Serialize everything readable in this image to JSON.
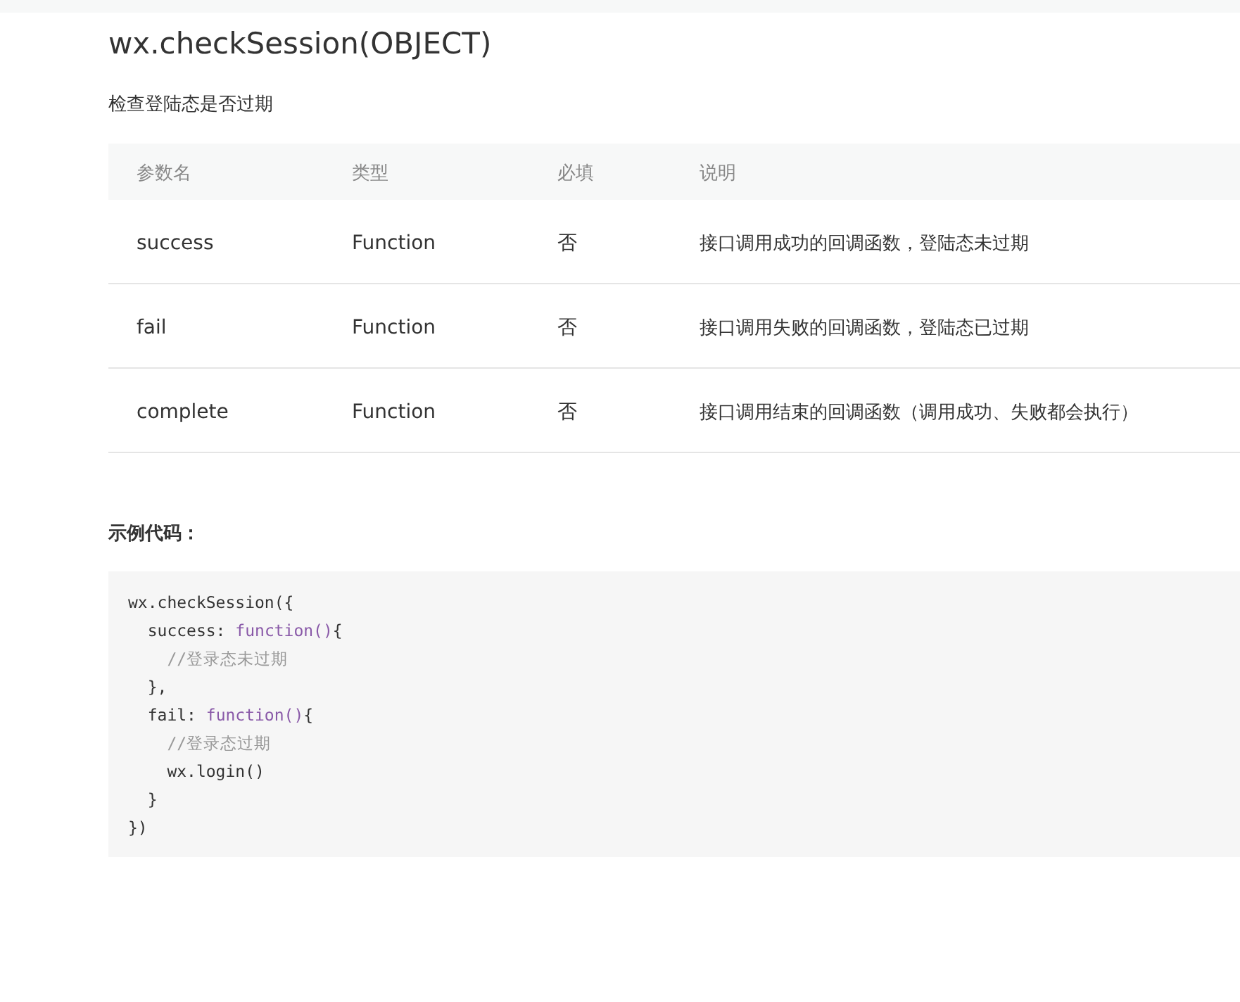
{
  "title": "wx.checkSession(OBJECT)",
  "description": "检查登陆态是否过期",
  "table": {
    "columns": [
      "参数名",
      "类型",
      "必填",
      "说明"
    ],
    "rows": [
      [
        "success",
        "Function",
        "否",
        "接口调用成功的回调函数，登陆态未过期"
      ],
      [
        "fail",
        "Function",
        "否",
        "接口调用失败的回调函数，登陆态已过期"
      ],
      [
        "complete",
        "Function",
        "否",
        "接口调用结束的回调函数（调用成功、失败都会执行）"
      ]
    ]
  },
  "example_heading": "示例代码：",
  "code": [
    [
      {
        "kind": "plain",
        "text": "wx.checkSession({"
      }
    ],
    [
      {
        "kind": "plain",
        "text": "  success: "
      },
      {
        "kind": "keyword",
        "text": "function()"
      },
      {
        "kind": "plain",
        "text": "{"
      }
    ],
    [
      {
        "kind": "comment",
        "text": "    //登录态未过期"
      }
    ],
    [
      {
        "kind": "plain",
        "text": "  },"
      }
    ],
    [
      {
        "kind": "plain",
        "text": "  fail: "
      },
      {
        "kind": "keyword",
        "text": "function()"
      },
      {
        "kind": "plain",
        "text": "{"
      }
    ],
    [
      {
        "kind": "comment",
        "text": "    //登录态过期"
      }
    ],
    [
      {
        "kind": "plain",
        "text": "    wx.login()"
      }
    ],
    [
      {
        "kind": "plain",
        "text": "  }"
      }
    ],
    [
      {
        "kind": "plain",
        "text": "})"
      }
    ]
  ]
}
